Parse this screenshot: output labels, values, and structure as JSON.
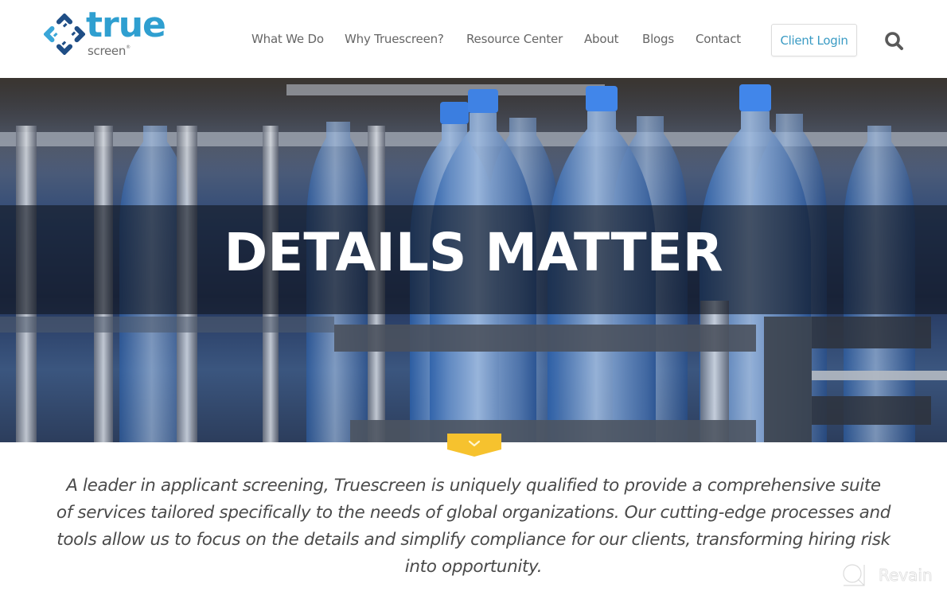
{
  "brand": {
    "name_primary": "true",
    "name_secondary": "screen",
    "registered_mark": "®",
    "logo_icon": "truescreen-logo-icon",
    "colors": {
      "primary_blue": "#2f9fd0",
      "dark_blue": "#1f4e86",
      "accent_yellow": "#f6c22e",
      "nav_text": "#666666",
      "link_blue": "#3a9bc4"
    }
  },
  "nav": {
    "items": [
      {
        "label": "What We Do"
      },
      {
        "label": "Why Truescreen?"
      },
      {
        "label": "Resource Center"
      },
      {
        "label": "About"
      },
      {
        "label": "Blogs"
      },
      {
        "label": "Contact"
      }
    ],
    "client_login_label": "Client Login",
    "search_icon": "search-icon"
  },
  "hero": {
    "title": "DETAILS MATTER",
    "background": "bottling-line-photo",
    "scroll_icon": "chevron-down-icon"
  },
  "intro": {
    "text": "A leader in applicant screening, Truescreen is uniquely qualified to provide a comprehensive suite of services tailored specifically to the needs of global organizations. Our cutting-edge processes and tools allow us to focus on the details and simplify compliance for our clients, transforming hiring risk into opportunity."
  },
  "watermark": {
    "label": "Revain",
    "icon": "revain-logo-icon"
  }
}
